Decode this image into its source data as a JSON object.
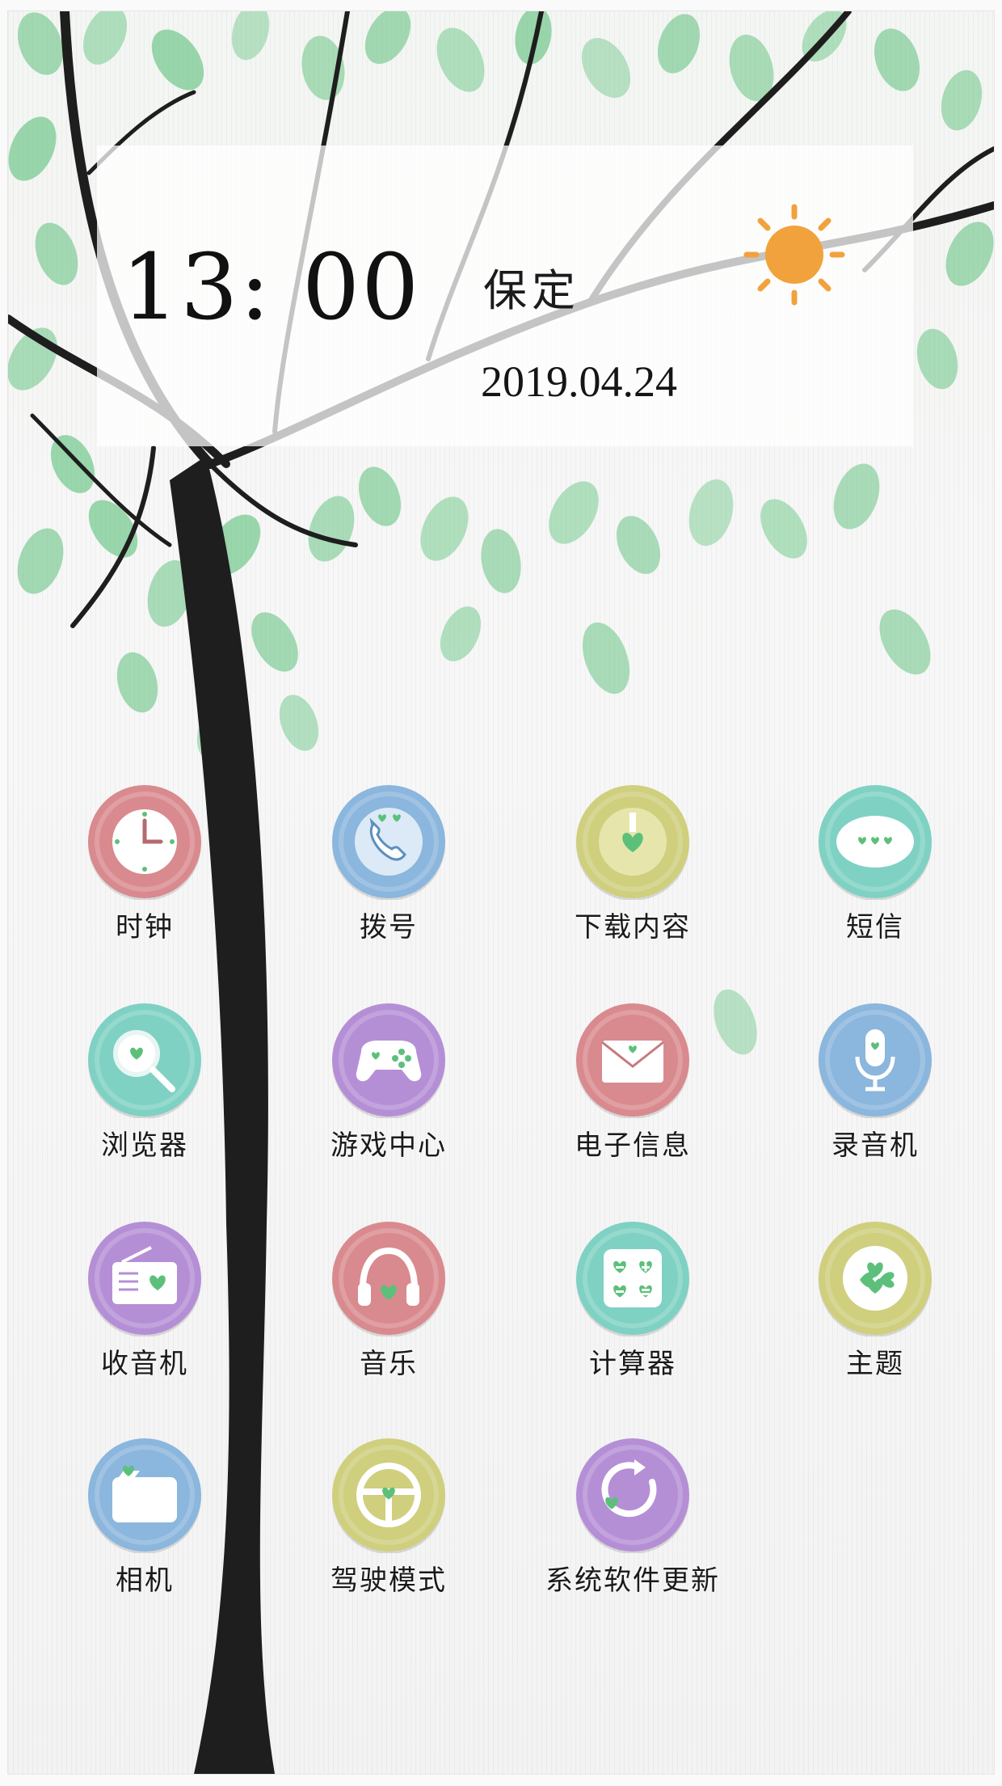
{
  "header": {
    "time": "13: 00",
    "city": "保定",
    "date": "2019.04.24",
    "weather_icon": "sun-icon"
  },
  "colors": {
    "red": "#d98a8e",
    "blue": "#8bb6dd",
    "olive": "#cfcf7e",
    "teal": "#7fd1c3",
    "purple": "#b58fd6",
    "leaf_green": "#5cc07a",
    "sun_orange": "#f2a23c"
  },
  "apps": [
    {
      "label": "时钟",
      "icon": "clock-icon"
    },
    {
      "label": "拨号",
      "icon": "phone-icon"
    },
    {
      "label": "下载内容",
      "icon": "download-icon"
    },
    {
      "label": "短信",
      "icon": "message-icon"
    },
    {
      "label": "浏览器",
      "icon": "browser-icon"
    },
    {
      "label": "游戏中心",
      "icon": "gamepad-icon"
    },
    {
      "label": "电子信息",
      "icon": "email-icon"
    },
    {
      "label": "录音机",
      "icon": "microphone-icon"
    },
    {
      "label": "收音机",
      "icon": "radio-icon"
    },
    {
      "label": "音乐",
      "icon": "headphones-icon"
    },
    {
      "label": "计算器",
      "icon": "calculator-icon"
    },
    {
      "label": "主题",
      "icon": "clover-icon"
    },
    {
      "label": "相机",
      "icon": "camera-icon"
    },
    {
      "label": "驾驶模式",
      "icon": "steering-wheel-icon"
    },
    {
      "label": "系统软件更新",
      "icon": "update-icon"
    }
  ]
}
